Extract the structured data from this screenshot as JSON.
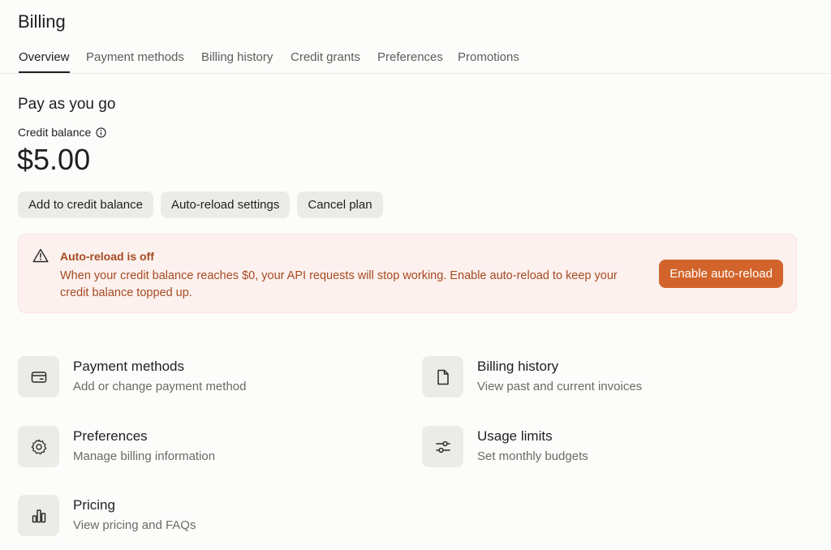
{
  "page": {
    "title": "Billing"
  },
  "tabs": [
    {
      "label": "Overview",
      "active": true
    },
    {
      "label": "Payment methods"
    },
    {
      "label": "Billing history"
    },
    {
      "label": "Credit grants"
    },
    {
      "label": "Preferences"
    },
    {
      "label": "Promotions"
    }
  ],
  "plan": {
    "title": "Pay as you go",
    "balance_label": "Credit balance",
    "balance_value": "$5.00",
    "info_icon": "info-icon"
  },
  "actions": {
    "add_credit": "Add to credit balance",
    "auto_reload_settings": "Auto-reload settings",
    "cancel_plan": "Cancel plan"
  },
  "alert": {
    "icon": "warning-icon",
    "title": "Auto-reload is off",
    "message": "When your credit balance reaches $0, your API requests will stop working. Enable auto-reload to keep your credit balance topped up.",
    "button": "Enable auto-reload",
    "accent": "#d2642b",
    "text_color": "#a64a22",
    "background": "#fcf1ee"
  },
  "cards": [
    {
      "icon": "credit-card-icon",
      "title": "Payment methods",
      "description": "Add or change payment method"
    },
    {
      "icon": "document-icon",
      "title": "Billing history",
      "description": "View past and current invoices"
    },
    {
      "icon": "gear-icon",
      "title": "Preferences",
      "description": "Manage billing information"
    },
    {
      "icon": "sliders-icon",
      "title": "Usage limits",
      "description": "Set monthly budgets"
    },
    {
      "icon": "bar-chart-icon",
      "title": "Pricing",
      "description": "View pricing and FAQs"
    }
  ]
}
